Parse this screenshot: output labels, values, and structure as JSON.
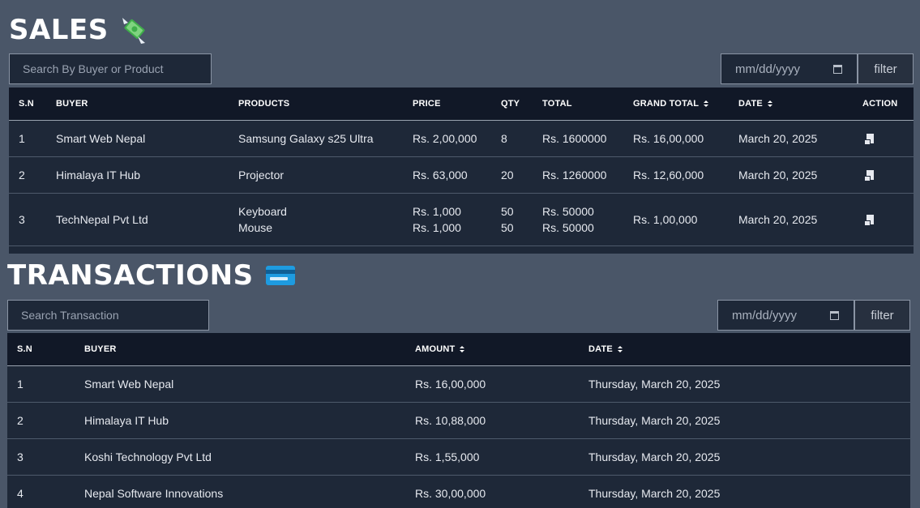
{
  "sales": {
    "title": "SALES",
    "icon": "money-with-wings-icon",
    "search_placeholder": "Search By Buyer or Product",
    "date_placeholder": "mm/dd/yyyy",
    "filter_label": "filter",
    "headers": {
      "sn": "S.N",
      "buyer": "BUYER",
      "products": "PRODUCTS",
      "price": "PRICE",
      "qty": "QTY",
      "total": "TOTAL",
      "grand_total": "GRAND TOTAL",
      "date": "DATE",
      "action": "ACTION"
    },
    "rows": [
      {
        "sn": "1",
        "buyer": "Smart Web Nepal",
        "products": [
          "Samsung Galaxy s25 Ultra"
        ],
        "prices": [
          "Rs. 2,00,000"
        ],
        "qtys": [
          "8"
        ],
        "totals": [
          "Rs. 1600000"
        ],
        "grand_total": "Rs. 16,00,000",
        "date": "March 20, 2025"
      },
      {
        "sn": "2",
        "buyer": "Himalaya IT Hub",
        "products": [
          "Projector"
        ],
        "prices": [
          "Rs. 63,000"
        ],
        "qtys": [
          "20"
        ],
        "totals": [
          "Rs. 1260000"
        ],
        "grand_total": "Rs. 12,60,000",
        "date": "March 20, 2025"
      },
      {
        "sn": "3",
        "buyer": "TechNepal Pvt Ltd",
        "products": [
          "Keyboard",
          "Mouse"
        ],
        "prices": [
          "Rs. 1,000",
          "Rs. 1,000"
        ],
        "qtys": [
          "50",
          "50"
        ],
        "totals": [
          "Rs. 50000",
          "Rs. 50000"
        ],
        "grand_total": "Rs. 1,00,000",
        "date": "March 20, 2025"
      }
    ]
  },
  "transactions": {
    "title": "TRANSACTIONS",
    "icon": "credit-card-icon",
    "search_placeholder": "Search Transaction",
    "date_placeholder": "mm/dd/yyyy",
    "filter_label": "filter",
    "headers": {
      "sn": "S.N",
      "buyer": "BUYER",
      "amount": "AMOUNT",
      "date": "DATE"
    },
    "rows": [
      {
        "sn": "1",
        "buyer": "Smart Web Nepal",
        "amount": "Rs. 16,00,000",
        "date": "Thursday, March 20, 2025"
      },
      {
        "sn": "2",
        "buyer": "Himalaya IT Hub",
        "amount": "Rs. 10,88,000",
        "date": "Thursday, March 20, 2025"
      },
      {
        "sn": "3",
        "buyer": "Koshi Technology Pvt Ltd",
        "amount": "Rs. 1,55,000",
        "date": "Thursday, March 20, 2025"
      },
      {
        "sn": "4",
        "buyer": "Nepal Software Innovations",
        "amount": "Rs. 30,00,000",
        "date": "Thursday, March 20, 2025"
      }
    ]
  }
}
